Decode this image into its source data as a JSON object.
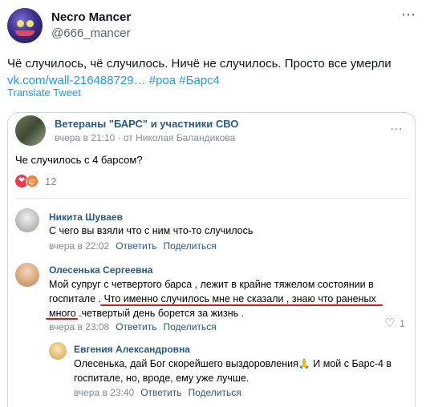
{
  "tweet": {
    "author_name": "Necro Mancer",
    "author_handle": "@666_mancer",
    "text_line1": "Чё случилось, чё случилось. Ничё не случилось. Просто все умерли",
    "link_text": "vk.com/wall-216488729…",
    "hashtags": "#роа #Барс4",
    "translate_label": "Translate Tweet",
    "more_icon": "⋯"
  },
  "card": {
    "group_name": "Ветераны \"БАРС\" и участники СВО",
    "group_meta": "вчера в 21:10  ·  от Николая Баландикова",
    "post_text": "Че случилось с 4 барсом?",
    "reaction_count": "12",
    "reaction_heart": "❤",
    "reaction_angry": "😡",
    "comments": [
      {
        "name": "Никита Шуваев",
        "text": "С чего вы взяли что с ним что-то случилось",
        "time": "вчера в 22:02",
        "reply": "Ответить",
        "share": "Поделиться"
      },
      {
        "name": "Олесенька Сергеевна",
        "text_line1": "Мой супруг с четвертого барса , лежит в крайне тяжелом состоянии в",
        "text_line2": "госпитале . Что именно случилось мне не сказали , знаю что раненых",
        "text_line3": "много .четвертый день борется за жизнь .",
        "time": "вчера в 23:08",
        "reply": "Ответить",
        "share": "Поделиться",
        "likes": "1"
      },
      {
        "name": "Евгения Александровна",
        "text_line1_a": "Олесенька, дай Бог скорейшего выздоровления",
        "emoji": "🙏",
        "text_line1_b": " И мой с Барс-4 в",
        "text_line2": "госпитале, но, вроде, ему уже лучше.",
        "time": "вчера в 23:40",
        "reply": "Ответить",
        "share": "Поделиться"
      }
    ]
  },
  "colors": {
    "twitter_blue": "#1d9bf0",
    "vk_link": "#2a5885",
    "underline_red": "#e0141e"
  }
}
